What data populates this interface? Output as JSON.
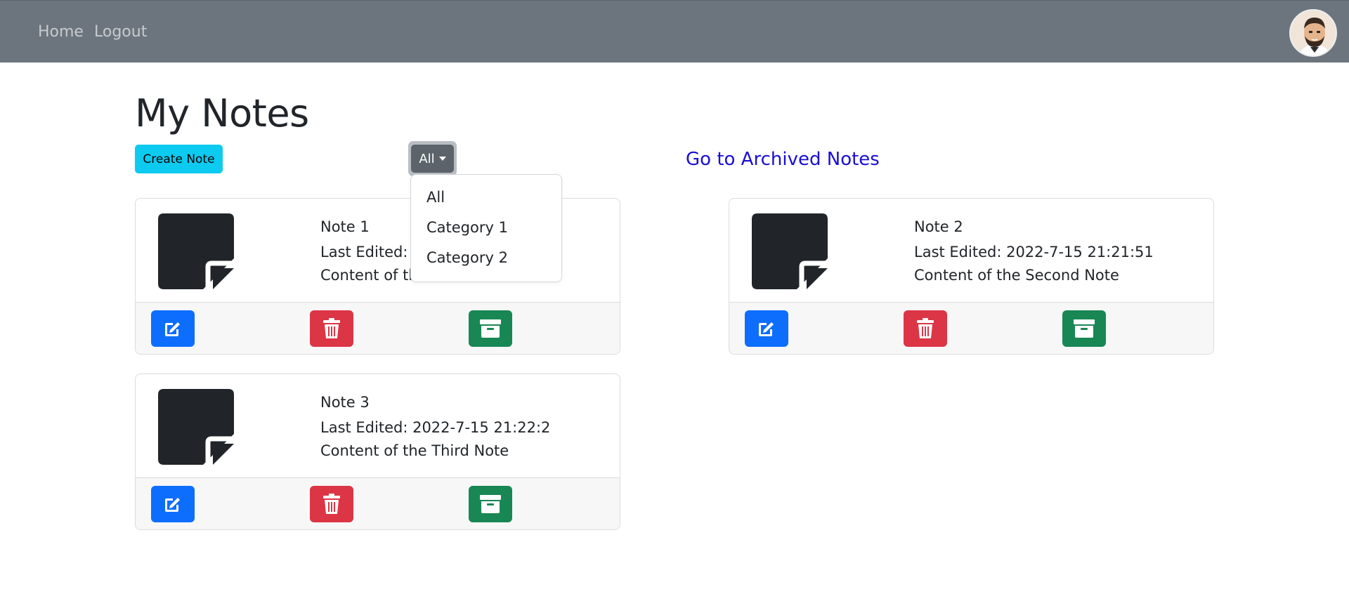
{
  "nav": {
    "home_label": "Home",
    "logout_label": "Logout"
  },
  "page": {
    "title": "My Notes",
    "create_button_label": "Create Note",
    "filter_button_label": "All",
    "archived_link_label": "Go to Archived Notes"
  },
  "filter_menu": {
    "options": [
      "All",
      "Category 1",
      "Category 2"
    ]
  },
  "notes": [
    {
      "title": "Note 1",
      "last_edited": "Last Edited: 20",
      "content": "Content of the"
    },
    {
      "title": "Note 2",
      "last_edited": "Last Edited: 2022-7-15 21:21:51",
      "content": "Content of the Second Note"
    },
    {
      "title": "Note 3",
      "last_edited": "Last Edited: 2022-7-15 21:22:2",
      "content": "Content of the Third Note"
    }
  ],
  "icons": {
    "note": "sticky-note-icon",
    "edit": "edit-icon",
    "delete": "trash-icon",
    "archive": "archive-icon",
    "avatar": "user-avatar"
  },
  "colors": {
    "navbar": "#6c757d",
    "create_button": "#0dcaf0",
    "filter_button": "#5c636a",
    "link": "#1a0dd6",
    "edit": "#0d6efd",
    "delete": "#dc3545",
    "archive": "#198754",
    "note_icon": "#212529"
  }
}
